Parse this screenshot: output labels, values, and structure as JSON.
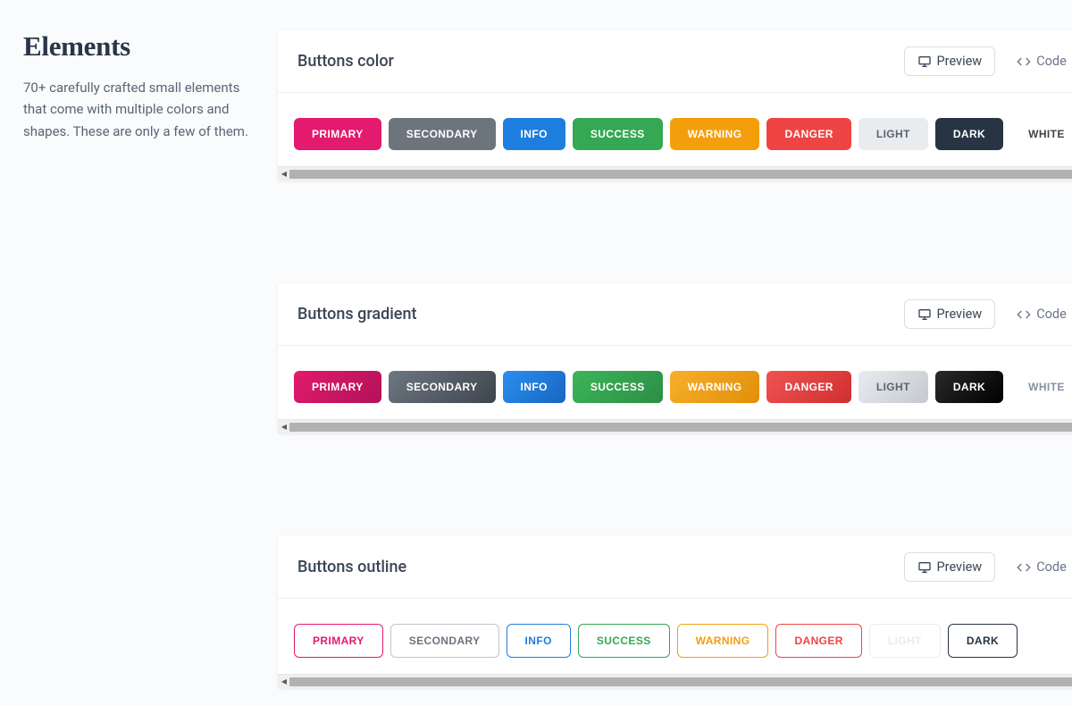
{
  "page": {
    "title": "Elements",
    "description": "70+ carefully crafted small elements that come with multiple colors and shapes. These are only a few of them."
  },
  "toggles": {
    "preview": "Preview",
    "code": "Code"
  },
  "sections": [
    {
      "key": "color",
      "title": "Buttons color"
    },
    {
      "key": "gradient",
      "title": "Buttons gradient"
    },
    {
      "key": "outline",
      "title": "Buttons outline"
    }
  ],
  "buttons": [
    "PRIMARY",
    "SECONDARY",
    "INFO",
    "SUCCESS",
    "WARNING",
    "DANGER",
    "LIGHT",
    "DARK",
    "WHITE"
  ]
}
